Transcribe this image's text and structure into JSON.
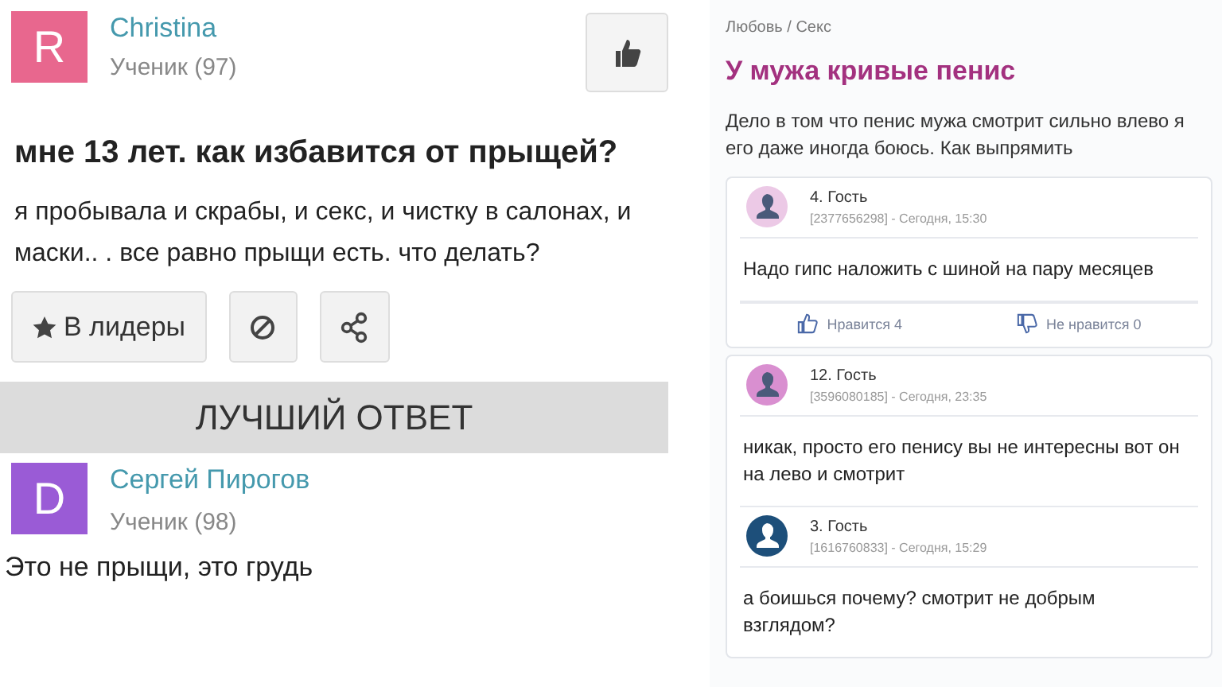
{
  "question": {
    "author": {
      "initial": "R",
      "name": "Christina",
      "rank": "Ученик (97)",
      "color": "#e8678e"
    },
    "title": "мне 13 лет. как избавится от прыщей?",
    "body": "я пробывала и скрабы, и секс, и чистку в салонах, и маски.. . все равно прыщи есть. что делать?",
    "actions": [
      {
        "kind": "star",
        "label": "В лидеры"
      },
      {
        "kind": "block"
      },
      {
        "kind": "share"
      }
    ]
  },
  "best_answer": {
    "heading": "ЛУЧШИЙ ОТВЕТ",
    "author": {
      "initial": "D",
      "name": "Сергей Пирогов",
      "rank": "Ученик (98)",
      "color": "#9a5bd6"
    },
    "text": "Это не прыщи, это грудь"
  },
  "topic": {
    "breadcrumb": "Любовь / Секс",
    "title": "У мужа кривые пенис",
    "text": "Дело в том что пенис мужа смотрит сильно влево я его даже иногда боюсь. Как выпрямить"
  },
  "cards": [
    {
      "comments": [
        {
          "name": "4. Гость",
          "meta": "[2377656298] - Сегодня, 15:30",
          "text": "Надо гипс наложить с шиной на пару месяцев",
          "color": "#ecc9e6"
        }
      ],
      "reactions": {
        "like": "Нравится 4",
        "dislike": "Не нравится 0"
      }
    },
    {
      "comments": [
        {
          "name": "12. Гость",
          "meta": "[3596080185] - Сегодня, 23:35",
          "text": "никак, просто его пенису вы не интересны вот он на лево и смотрит",
          "color": "#d98fd0"
        },
        {
          "name": "3. Гость",
          "meta": "[1616760833] - Сегодня, 15:29",
          "text": "а боишься почему? смотрит не добрым взглядом?",
          "color": "#1d4f7a"
        }
      ]
    }
  ]
}
